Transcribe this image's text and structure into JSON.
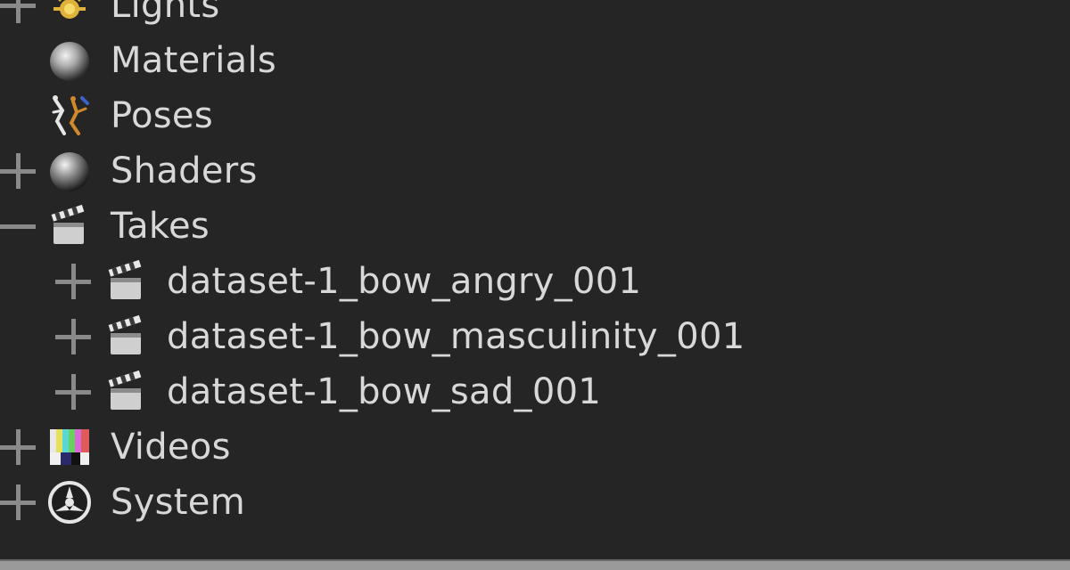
{
  "tree": {
    "items": [
      {
        "label": "Lights",
        "icon": "lights-icon",
        "toggle": "expand"
      },
      {
        "label": "Materials",
        "icon": "sphere-icon",
        "toggle": "none"
      },
      {
        "label": "Poses",
        "icon": "pose-figure-icon",
        "toggle": "none"
      },
      {
        "label": "Shaders",
        "icon": "sphere-icon",
        "toggle": "expand"
      },
      {
        "label": "Takes",
        "icon": "clapperboard-icon",
        "toggle": "collapse"
      },
      {
        "label": "dataset-1_bow_angry_001",
        "icon": "clapperboard-icon",
        "toggle": "expand"
      },
      {
        "label": "dataset-1_bow_masculinity_001",
        "icon": "clapperboard-icon",
        "toggle": "expand"
      },
      {
        "label": "dataset-1_bow_sad_001",
        "icon": "clapperboard-icon",
        "toggle": "expand"
      },
      {
        "label": "Videos",
        "icon": "color-bars-icon",
        "toggle": "expand"
      },
      {
        "label": "System",
        "icon": "system-wheel-icon",
        "toggle": "expand"
      }
    ]
  }
}
